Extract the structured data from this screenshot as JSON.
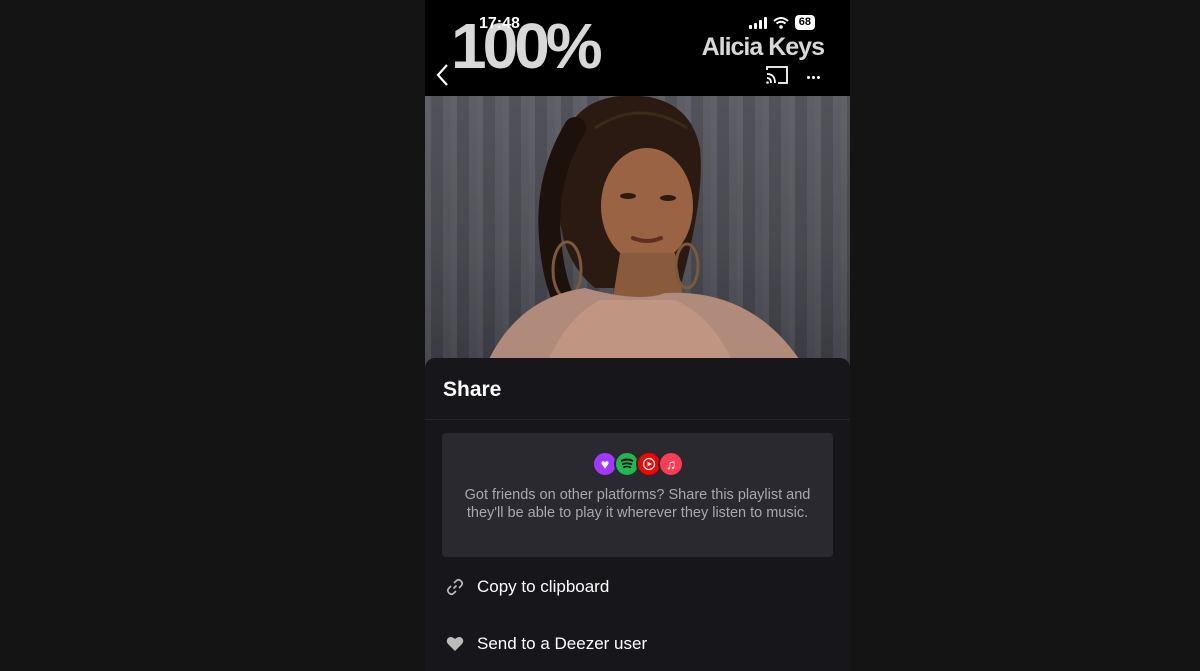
{
  "status_bar": {
    "time": "17:48",
    "battery": "68"
  },
  "header": {
    "playlist_title": "100%",
    "artist_name": "Alicia Keys"
  },
  "share_sheet": {
    "title": "Share",
    "platform_icons": [
      {
        "name": "deezer-icon",
        "color": "#a238ff",
        "glyph": "♥"
      },
      {
        "name": "spotify-icon",
        "color": "#1db954",
        "glyph": "≋"
      },
      {
        "name": "youtube-music-icon",
        "color": "#ff0000",
        "glyph": "▶"
      },
      {
        "name": "apple-music-icon",
        "color": "#fa3c54",
        "glyph": "♫"
      }
    ],
    "info_text": "Got friends on other platforms? Share this playlist and they'll be able to play it wherever they listen to music.",
    "actions": [
      {
        "label": "Copy to clipboard",
        "icon": "link-icon"
      },
      {
        "label": "Send to a Deezer user",
        "icon": "heart-icon"
      }
    ]
  },
  "colors": {
    "background": "#141414",
    "sheet_background": "#17161b",
    "card_background": "#2a292f"
  }
}
